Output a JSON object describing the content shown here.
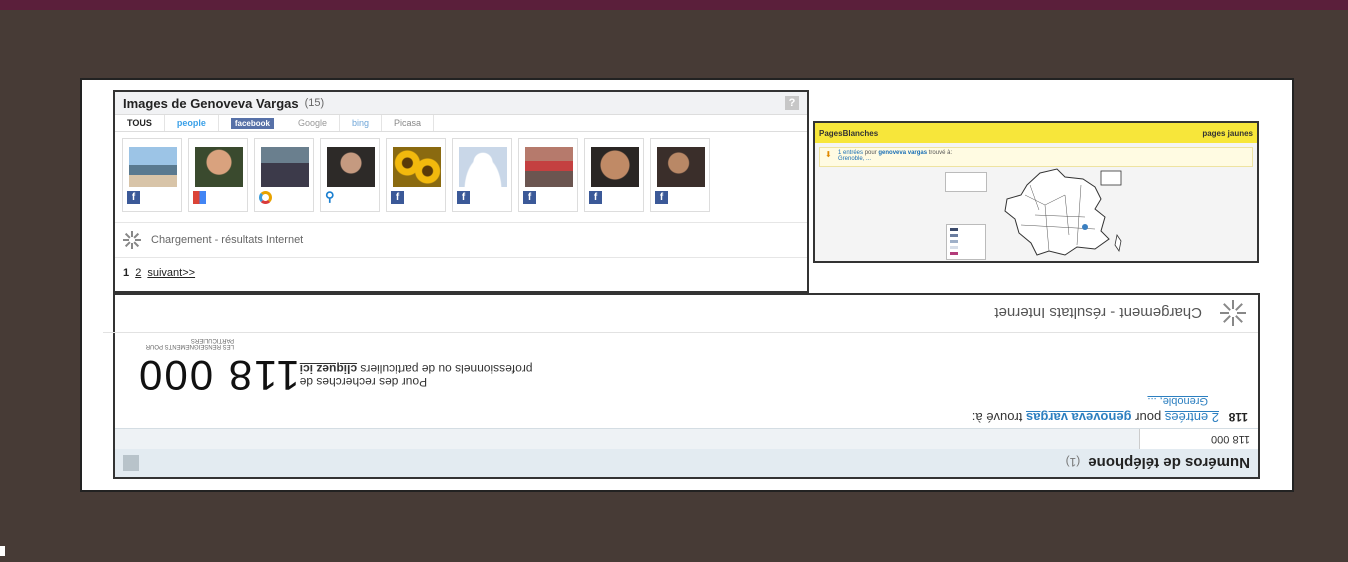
{
  "images_panel": {
    "title": "Images de Genoveva Vargas",
    "count": "(15)",
    "help": "?",
    "tabs": [
      "TOUS",
      "people",
      "facebook",
      "Google",
      "bing",
      "Picasa"
    ],
    "thumb_sources": [
      "facebook",
      "google",
      "picasa",
      "search",
      "facebook",
      "facebook",
      "facebook",
      "facebook",
      "facebook"
    ],
    "loading_text": "Chargement - résultats Internet",
    "pager": {
      "current": "1",
      "page2": "2",
      "next": "suivant>>"
    }
  },
  "pages_blanches": {
    "logo": "PagesBlanches",
    "pagesjaunes": "pages jaunes",
    "entries_link": "1 entrées",
    "for": "pour",
    "name": "genoveva vargas",
    "found": "trouvé à:",
    "city": "Grenoble, ..."
  },
  "flipped_panel": {
    "title": "Numéros de téléphone",
    "count": "(1)",
    "tab": "118 000",
    "entries_link": "2 entrées",
    "for": "pour",
    "name": "genoveva vargas",
    "found": "trouvé à:",
    "city": "Grenoble, ...",
    "big_number": "118 000",
    "promo_line1": "Pour des recherches de",
    "promo_line2_pre": "professionnels ou de particuliers",
    "promo_link": "cliquez ici",
    "small_note": "LES RENSEIGNEMENTS POUR PARTICULIERS",
    "loading_text": "Chargement - résultats Internet"
  },
  "colors": {
    "background": "#473b36",
    "topbar": "#5b1f3b",
    "facebook": "#3b5998",
    "pages_yellow": "#f7e63a"
  }
}
